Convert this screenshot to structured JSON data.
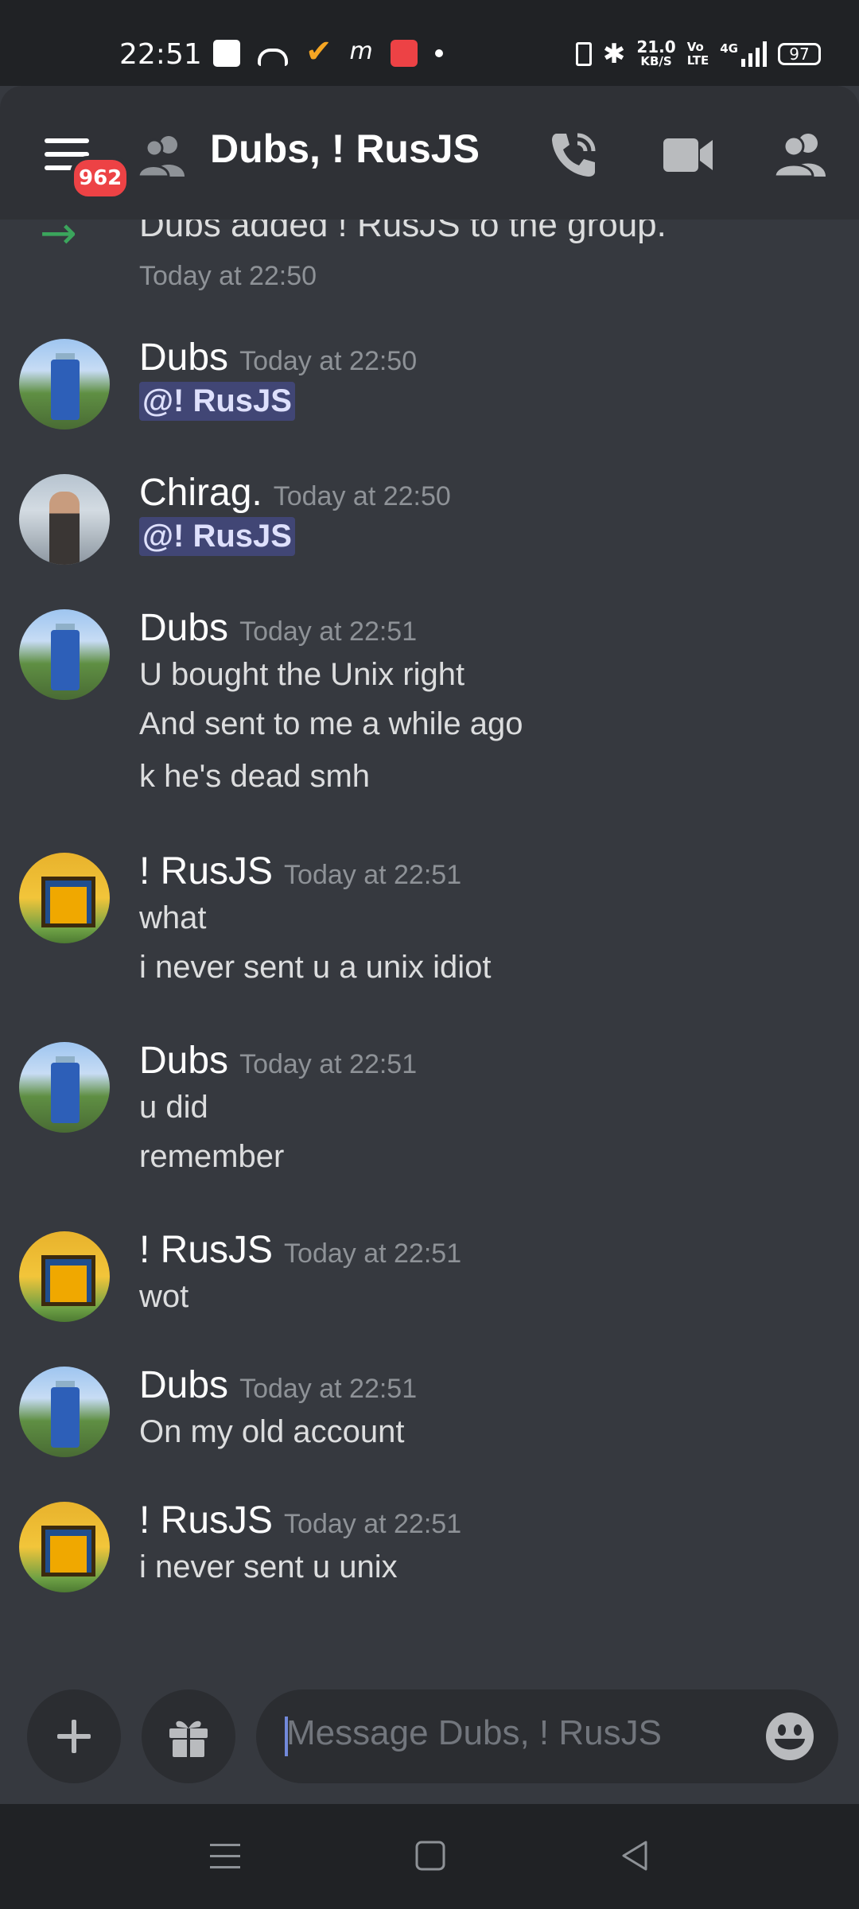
{
  "status_bar": {
    "time": "22:51",
    "net_speed": "21.0",
    "net_unit": "KB/S",
    "volte_top": "Vo",
    "volte_bottom": "LTE",
    "network": "4G",
    "battery": "97"
  },
  "header": {
    "notification_count": "962",
    "title": "Dubs, ! RusJS",
    "icons": [
      "menu-icon",
      "dm-group-icon",
      "call-icon",
      "video-icon",
      "members-icon"
    ]
  },
  "system_message": {
    "text": "Dubs added ! RusJS to the group.",
    "time": "Today at 22:50"
  },
  "messages": [
    {
      "author": "Dubs",
      "time": "Today at 22:50",
      "mention": "@! RusJS",
      "lines": []
    },
    {
      "author": "Chirag.",
      "time": "Today at 22:50",
      "mention": "@! RusJS",
      "lines": []
    },
    {
      "author": "Dubs",
      "time": "Today at 22:51",
      "lines": [
        "U bought the Unix right",
        "And sent to me a while ago",
        "k he's dead smh"
      ]
    },
    {
      "author": "! RusJS",
      "time": "Today at 22:51",
      "lines": [
        "what",
        "i never sent u a unix idiot"
      ]
    },
    {
      "author": "Dubs",
      "time": "Today at 22:51",
      "lines": [
        "u did",
        "remember"
      ]
    },
    {
      "author": "! RusJS",
      "time": "Today at 22:51",
      "lines": [
        "wot"
      ]
    },
    {
      "author": "Dubs",
      "time": "Today at 22:51",
      "lines": [
        "On my old account"
      ]
    },
    {
      "author": "! RusJS",
      "time": "Today at 22:51",
      "lines": [
        "i never sent u unix"
      ]
    }
  ],
  "composer": {
    "placeholder": "Message Dubs, ! RusJS"
  },
  "colors": {
    "background": "#36393f",
    "header": "#2f3136",
    "accent": "#7289da",
    "mention_bg": "#414675",
    "badge": "#ed4245",
    "join_arrow": "#3ba55c"
  }
}
